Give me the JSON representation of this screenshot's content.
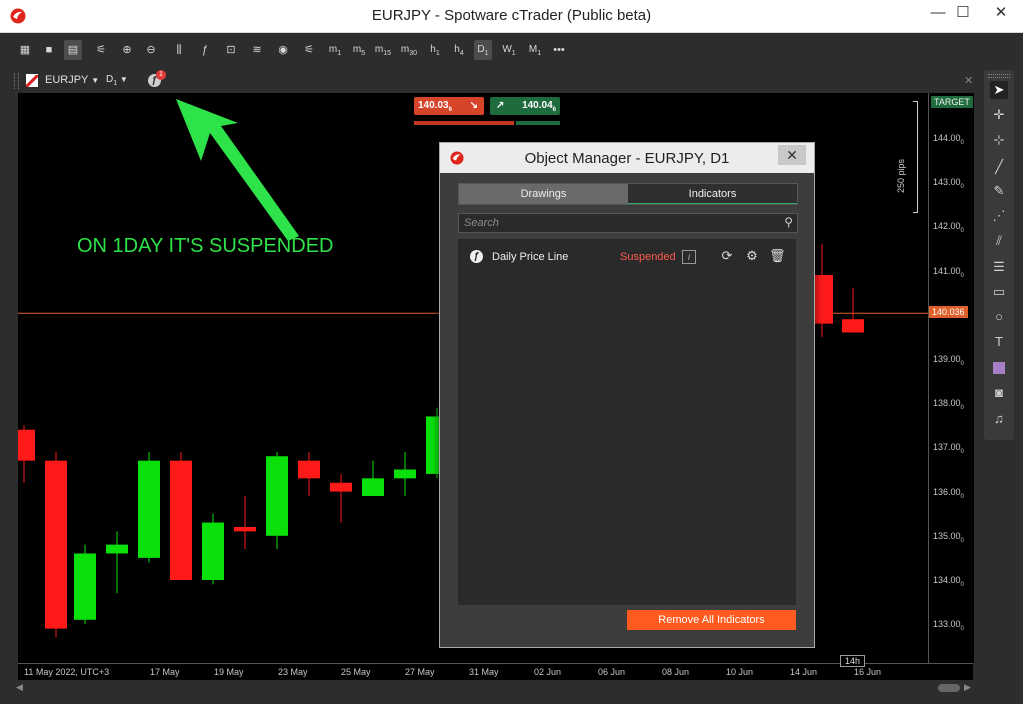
{
  "window": {
    "title": "EURJPY - Spotware cTrader (Public beta)",
    "minimize": "—",
    "maximize": "☐",
    "close": "✕"
  },
  "toolbar": {
    "timeframes": [
      {
        "base": "m",
        "sub": "1"
      },
      {
        "base": "m",
        "sub": "5"
      },
      {
        "base": "m",
        "sub": "15"
      },
      {
        "base": "m",
        "sub": "30"
      },
      {
        "base": "h",
        "sub": "1"
      },
      {
        "base": "h",
        "sub": "4"
      },
      {
        "base": "D",
        "sub": "1"
      },
      {
        "base": "W",
        "sub": "1"
      },
      {
        "base": "M",
        "sub": "1"
      }
    ],
    "active_timeframe": "D",
    "more": "•••"
  },
  "chart_tab": {
    "symbol": "EURJPY",
    "timeframe": "D",
    "timeframe_sub": "1",
    "notification_count": "1"
  },
  "prices": {
    "sell": "140.03",
    "sell_sub": "6",
    "buy": "140.04",
    "buy_sub": "6",
    "current": "140.036",
    "target_label": "TARGET",
    "pips_label": "250 pips"
  },
  "price_axis": [
    {
      "label": "144.00",
      "sub": "0"
    },
    {
      "label": "143.00",
      "sub": "0"
    },
    {
      "label": "142.00",
      "sub": "0"
    },
    {
      "label": "141.00",
      "sub": "0"
    },
    {
      "label": "139.00",
      "sub": "0"
    },
    {
      "label": "138.00",
      "sub": "0"
    },
    {
      "label": "137.00",
      "sub": "0"
    },
    {
      "label": "136.00",
      "sub": "0"
    },
    {
      "label": "135.00",
      "sub": "0"
    },
    {
      "label": "134.00",
      "sub": "0"
    },
    {
      "label": "133.00",
      "sub": "0"
    }
  ],
  "time_axis": [
    "11 May 2022, UTC+3",
    "17 May",
    "19 May",
    "23 May",
    "25 May",
    "27 May",
    "31 May",
    "02 Jun",
    "06 Jun",
    "08 Jun",
    "10 Jun",
    "14 Jun",
    "16 Jun"
  ],
  "time_cursor": "14h",
  "candles": [
    {
      "o": 137.4,
      "c": 136.7,
      "h": 137.5,
      "l": 136.2
    },
    {
      "o": 136.7,
      "c": 132.9,
      "h": 136.9,
      "l": 132.7
    },
    {
      "o": 133.1,
      "c": 134.6,
      "h": 134.8,
      "l": 133.0
    },
    {
      "o": 134.6,
      "c": 134.8,
      "h": 135.1,
      "l": 133.7
    },
    {
      "o": 134.5,
      "c": 136.7,
      "h": 136.9,
      "l": 134.4
    },
    {
      "o": 136.7,
      "c": 134.0,
      "h": 136.9,
      "l": 134.0
    },
    {
      "o": 134.0,
      "c": 135.3,
      "h": 135.5,
      "l": 133.9
    },
    {
      "o": 135.2,
      "c": 135.1,
      "h": 135.9,
      "l": 134.7
    },
    {
      "o": 135.0,
      "c": 136.8,
      "h": 136.9,
      "l": 134.7
    },
    {
      "o": 136.7,
      "c": 136.3,
      "h": 136.9,
      "l": 135.9
    },
    {
      "o": 136.2,
      "c": 136.0,
      "h": 136.4,
      "l": 135.3
    },
    {
      "o": 135.9,
      "c": 136.3,
      "h": 136.7,
      "l": 135.9
    },
    {
      "o": 136.3,
      "c": 136.5,
      "h": 136.9,
      "l": 135.9
    },
    {
      "o": 136.4,
      "c": 137.7,
      "h": 137.9,
      "l": 136.3
    },
    {
      "o": 140.9,
      "c": 139.8,
      "h": 141.6,
      "l": 139.5
    },
    {
      "o": 139.9,
      "c": 139.6,
      "h": 140.6,
      "l": 139.6
    }
  ],
  "annotation": {
    "text": "ON 1DAY IT'S SUSPENDED",
    "color": "#2ee24a"
  },
  "dialog": {
    "title": "Object Manager - EURJPY, D1",
    "tab_drawings": "Drawings",
    "tab_indicators": "Indicators",
    "search_placeholder": "Search",
    "row": {
      "name": "Daily Price Line",
      "status": "Suspended",
      "info": "i"
    },
    "remove_all": "Remove All Indicators"
  },
  "colors": {
    "bull": "#0ae00a",
    "bear": "#ff1a1a",
    "current_line": "#e0602a",
    "accent": "#ff5a1f"
  }
}
